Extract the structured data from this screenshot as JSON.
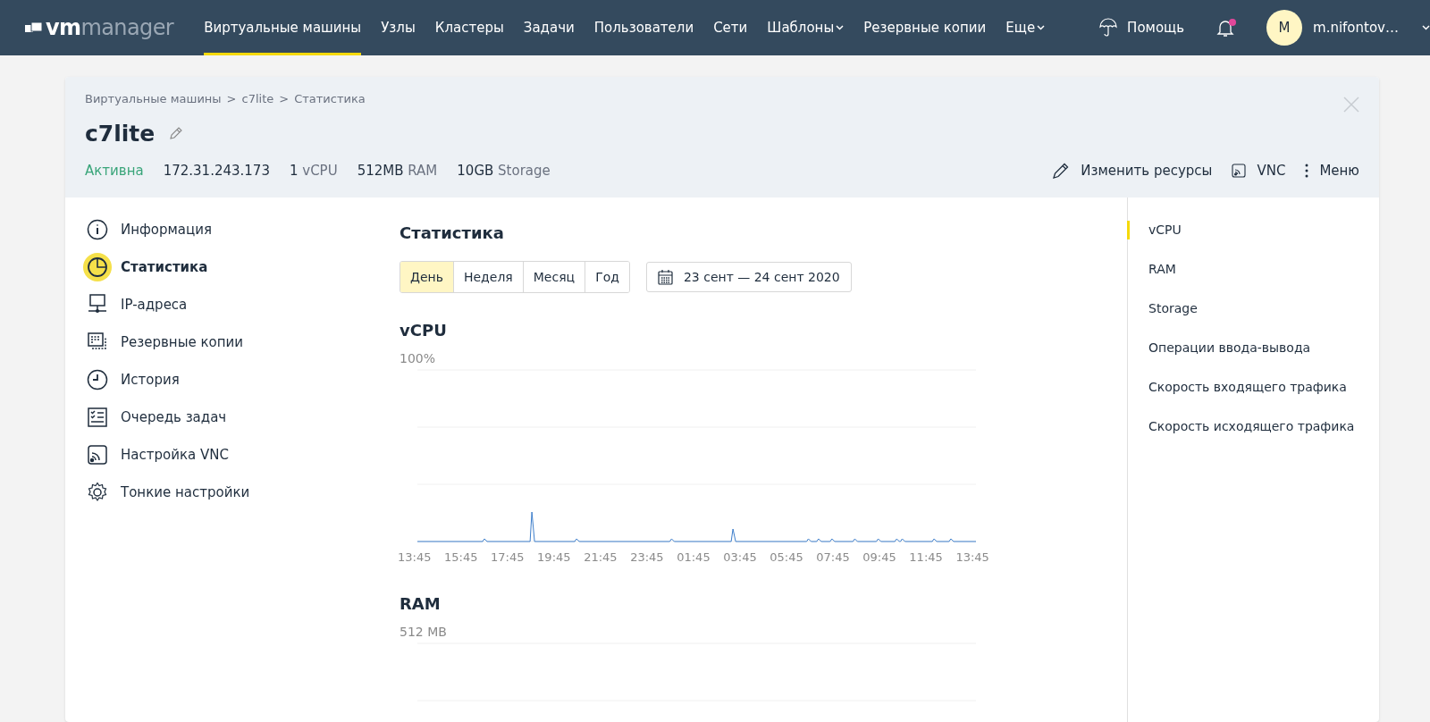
{
  "logo": {
    "part1": "vm",
    "part2": "manager"
  },
  "nav": [
    {
      "label": "Виртуальные машины",
      "selected": true,
      "dropdown": false
    },
    {
      "label": "Узлы",
      "selected": false,
      "dropdown": false
    },
    {
      "label": "Кластеры",
      "selected": false,
      "dropdown": false
    },
    {
      "label": "Задачи",
      "selected": false,
      "dropdown": false
    },
    {
      "label": "Пользователи",
      "selected": false,
      "dropdown": false
    },
    {
      "label": "Сети",
      "selected": false,
      "dropdown": false
    },
    {
      "label": "Шаблоны",
      "selected": false,
      "dropdown": true
    },
    {
      "label": "Резервные копии",
      "selected": false,
      "dropdown": false
    },
    {
      "label": "Еще",
      "selected": false,
      "dropdown": true
    }
  ],
  "help": "Помощь",
  "notifications": {
    "unread": true
  },
  "user": {
    "avatar": "M",
    "name": "m.nifontov…"
  },
  "breadcrumbs": [
    "Виртуальные машины",
    ">",
    "c7lite",
    ">",
    "Статистика"
  ],
  "vm": {
    "name": "c7lite",
    "status": "Активна",
    "ip": "172.31.243.173",
    "specs": [
      {
        "value": "1",
        "unit": "vCPU"
      },
      {
        "value": "512MB",
        "unit": "RAM"
      },
      {
        "value": "10GB",
        "unit": "Storage"
      }
    ]
  },
  "actions": [
    {
      "kind": "edit",
      "label": "Изменить ресурсы"
    },
    {
      "kind": "vnc",
      "label": "VNC"
    },
    {
      "kind": "menu",
      "label": "Меню"
    }
  ],
  "sidebar": [
    {
      "kind": "info",
      "label": "Информация",
      "selected": false
    },
    {
      "kind": "stats",
      "label": "Статистика",
      "selected": true
    },
    {
      "kind": "ip",
      "label": "IP-адреса",
      "selected": false
    },
    {
      "kind": "backup",
      "label": "Резервные копии",
      "selected": false
    },
    {
      "kind": "history",
      "label": "История",
      "selected": false
    },
    {
      "kind": "queue",
      "label": "Очередь задач",
      "selected": false
    },
    {
      "kind": "vnc",
      "label": "Настройка VNC",
      "selected": false
    },
    {
      "kind": "settings",
      "label": "Тонкие настройки",
      "selected": false
    }
  ],
  "section_title": "Статистика",
  "periods": [
    {
      "label": "День",
      "selected": true
    },
    {
      "label": "Неделя",
      "selected": false
    },
    {
      "label": "Месяц",
      "selected": false
    },
    {
      "label": "Год",
      "selected": false
    }
  ],
  "date_range": "23 сент — 24 сент 2020",
  "charts": [
    {
      "title": "vCPU",
      "top_label": "100%",
      "x_labels": [
        "13:45",
        "15:45",
        "17:45",
        "19:45",
        "21:45",
        "23:45",
        "01:45",
        "03:45",
        "05:45",
        "07:45",
        "09:45",
        "11:45",
        "13:45"
      ]
    },
    {
      "title": "RAM",
      "top_label": "512 MB"
    }
  ],
  "metrics": [
    {
      "label": "vCPU",
      "selected": true
    },
    {
      "label": "RAM",
      "selected": false
    },
    {
      "label": "Storage",
      "selected": false
    },
    {
      "label": "Операции ввода-вывода",
      "selected": false
    },
    {
      "label": "Скорость входящего трафика",
      "selected": false
    },
    {
      "label": "Скорость исходящего трафика",
      "selected": false
    }
  ]
}
